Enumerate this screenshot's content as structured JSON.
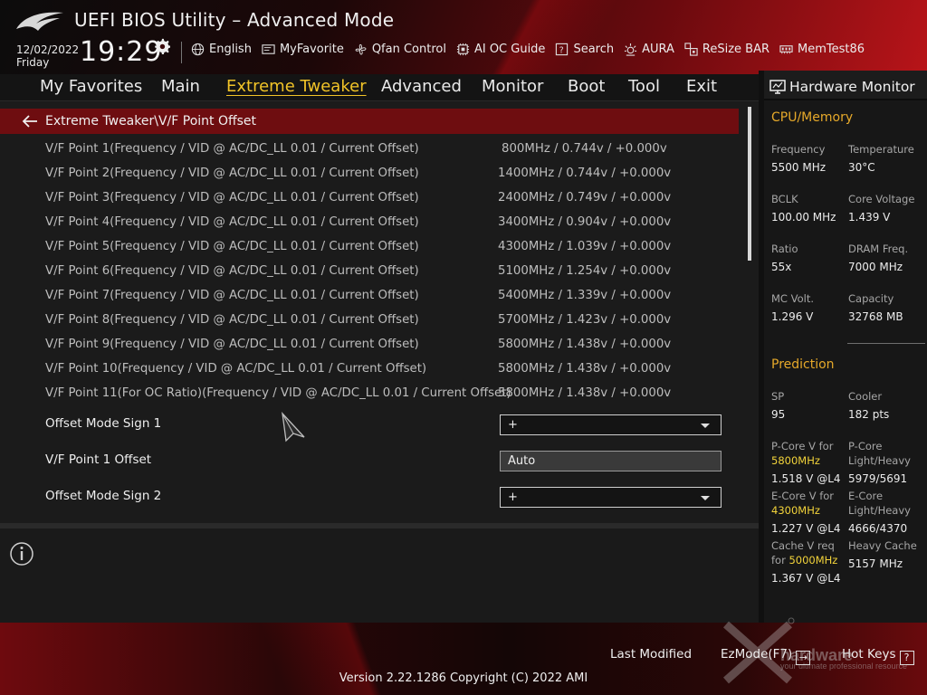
{
  "header": {
    "title": "UEFI BIOS Utility – Advanced Mode",
    "date": "12/02/2022",
    "day": "Friday",
    "time": "19:29",
    "tools": [
      {
        "label": "English",
        "icon": "globe-icon"
      },
      {
        "label": "MyFavorite",
        "icon": "favorite-icon"
      },
      {
        "label": "Qfan Control",
        "icon": "fan-icon"
      },
      {
        "label": "AI OC Guide",
        "icon": "ai-oc-icon"
      },
      {
        "label": "Search",
        "icon": "search-help-icon"
      },
      {
        "label": "AURA",
        "icon": "aura-icon"
      },
      {
        "label": "ReSize BAR",
        "icon": "resize-bar-icon"
      },
      {
        "label": "MemTest86",
        "icon": "memtest-icon"
      }
    ]
  },
  "nav": {
    "tabs": [
      "My Favorites",
      "Main",
      "Extreme Tweaker",
      "Advanced",
      "Monitor",
      "Boot",
      "Tool",
      "Exit"
    ],
    "active": "Extreme Tweaker"
  },
  "main": {
    "breadcrumb": "Extreme Tweaker\\V/F Point Offset",
    "vf_points": [
      {
        "label": "V/F Point 1(Frequency / VID @ AC/DC_LL 0.01 / Current Offset)",
        "value": "800MHz / 0.744v / +0.000v"
      },
      {
        "label": "V/F Point 2(Frequency / VID @ AC/DC_LL 0.01 / Current Offset)",
        "value": "1400MHz / 0.744v / +0.000v"
      },
      {
        "label": "V/F Point 3(Frequency / VID @ AC/DC_LL 0.01 / Current Offset)",
        "value": "2400MHz / 0.749v / +0.000v"
      },
      {
        "label": "V/F Point 4(Frequency / VID @ AC/DC_LL 0.01 / Current Offset)",
        "value": "3400MHz / 0.904v / +0.000v"
      },
      {
        "label": "V/F Point 5(Frequency / VID @ AC/DC_LL 0.01 / Current Offset)",
        "value": "4300MHz / 1.039v / +0.000v"
      },
      {
        "label": "V/F Point 6(Frequency / VID @ AC/DC_LL 0.01 / Current Offset)",
        "value": "5100MHz / 1.254v / +0.000v"
      },
      {
        "label": "V/F Point 7(Frequency / VID @ AC/DC_LL 0.01 / Current Offset)",
        "value": "5400MHz / 1.339v / +0.000v"
      },
      {
        "label": "V/F Point 8(Frequency / VID @ AC/DC_LL 0.01 / Current Offset)",
        "value": "5700MHz / 1.423v / +0.000v"
      },
      {
        "label": "V/F Point 9(Frequency / VID @ AC/DC_LL 0.01 / Current Offset)",
        "value": "5800MHz / 1.438v / +0.000v"
      },
      {
        "label": "V/F Point 10(Frequency / VID @ AC/DC_LL 0.01 / Current Offset)",
        "value": "5800MHz / 1.438v / +0.000v"
      },
      {
        "label": "V/F Point 11(For OC Ratio)(Frequency / VID @ AC/DC_LL 0.01 / Current Offset)",
        "value": "5800MHz / 1.438v / +0.000v"
      }
    ],
    "options": [
      {
        "label": "Offset Mode Sign 1",
        "value": "+",
        "control": "dropdown"
      },
      {
        "label": "V/F Point 1 Offset",
        "value": "Auto",
        "control": "text"
      },
      {
        "label": "Offset Mode Sign 2",
        "value": "+",
        "control": "dropdown"
      }
    ]
  },
  "hw_monitor": {
    "title": "Hardware Monitor",
    "cpu_memory": {
      "title": "CPU/Memory",
      "frequency_label": "Frequency",
      "frequency": "5500 MHz",
      "temperature_label": "Temperature",
      "temperature": "30°C",
      "bclk_label": "BCLK",
      "bclk": "100.00 MHz",
      "core_voltage_label": "Core Voltage",
      "core_voltage": "1.439 V",
      "ratio_label": "Ratio",
      "ratio": "55x",
      "dram_freq_label": "DRAM Freq.",
      "dram_freq": "7000 MHz",
      "mc_volt_label": "MC Volt.",
      "mc_volt": "1.296 V",
      "capacity_label": "Capacity",
      "capacity": "32768 MB"
    },
    "prediction": {
      "title": "Prediction",
      "sp_label": "SP",
      "sp": "95",
      "cooler_label": "Cooler",
      "cooler": "182 pts",
      "pcore_v_label": "P-Core V for",
      "pcore_v_freq": "5800MHz",
      "pcore_v": "1.518 V @L4",
      "pcore_lh_label_1": "P-Core",
      "pcore_lh_label_2": "Light/Heavy",
      "pcore_lh": "5979/5691",
      "ecore_v_label": "E-Core V for",
      "ecore_v_freq": "4300MHz",
      "ecore_v": "1.227 V @L4",
      "ecore_lh_label_1": "E-Core",
      "ecore_lh_label_2": "Light/Heavy",
      "ecore_lh": "4666/4370",
      "cache_v_label_1": "Cache V req",
      "cache_v_label_2": "for",
      "cache_v_freq": "5000MHz",
      "cache_v": "1.367 V @L4",
      "heavy_cache_label": "Heavy Cache",
      "heavy_cache": "5157 MHz"
    }
  },
  "footer": {
    "last_modified": "Last Modified",
    "ez_mode": "EzMode(F7)",
    "ez_mode_key": "→",
    "hot_keys": "Hot Keys",
    "hot_keys_key": "?",
    "version": "Version 2.22.1286 Copyright (C) 2022 AMI",
    "watermark": "hardware",
    "watermark_sub": "your ultimate professional resource"
  },
  "colors": {
    "accent": "#f2c428",
    "section_title": "#e6a92a",
    "breadcrumb_bg": "#6e0d10",
    "highlight": "#f2d33a"
  }
}
